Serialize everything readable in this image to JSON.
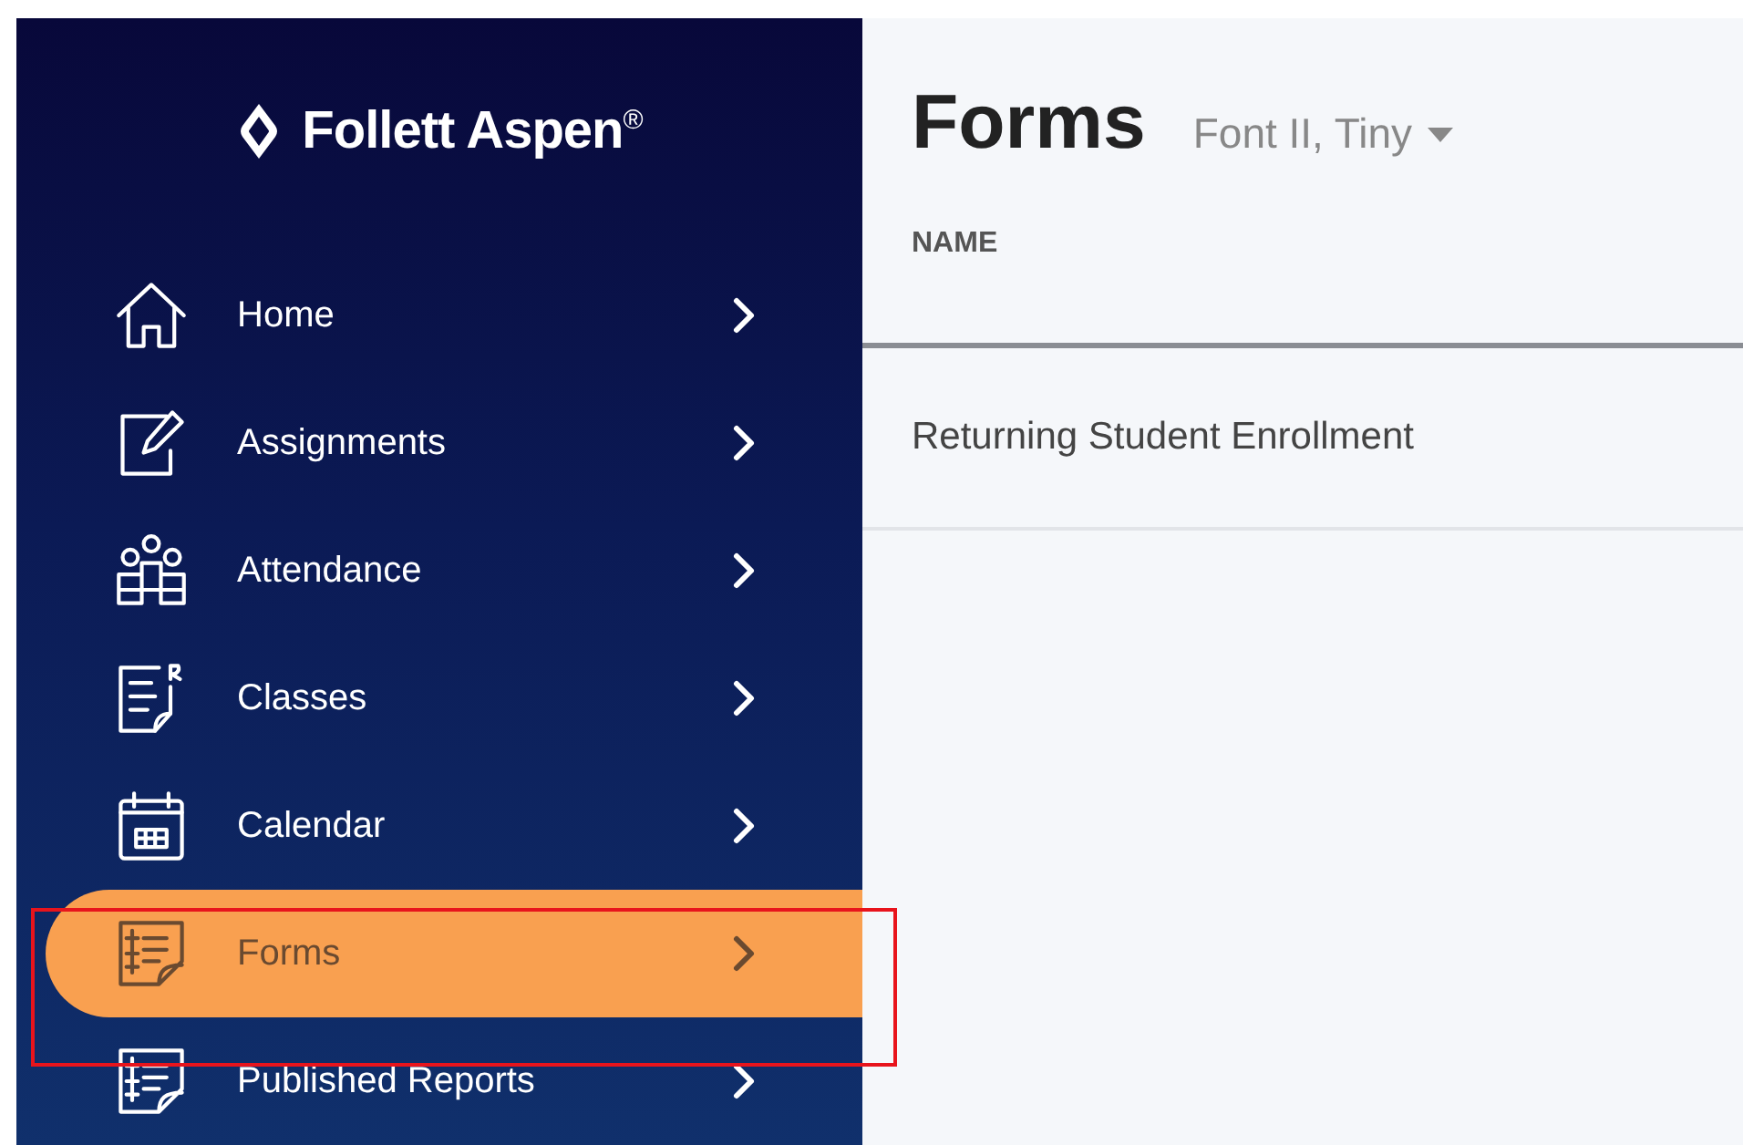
{
  "logo": {
    "text": "Follett Aspen$^{®}$"
  },
  "sidebar": {
    "items": [
      {
        "label": "Home",
        "selected": false
      },
      {
        "label": "Assignments",
        "selected": false
      },
      {
        "label": "Attendance",
        "selected": false
      },
      {
        "label": "Classes",
        "selected": false
      },
      {
        "label": "Calendar",
        "selected": false
      },
      {
        "label": "Forms",
        "selected": true
      },
      {
        "label": "Published Reports",
        "selected": false
      }
    ]
  },
  "page": {
    "title": "Forms",
    "filter": "Font II, Tiny"
  },
  "table": {
    "columns": [
      "NAME"
    ],
    "rows": [
      [
        "Returning Student Enrollment"
      ]
    ]
  }
}
